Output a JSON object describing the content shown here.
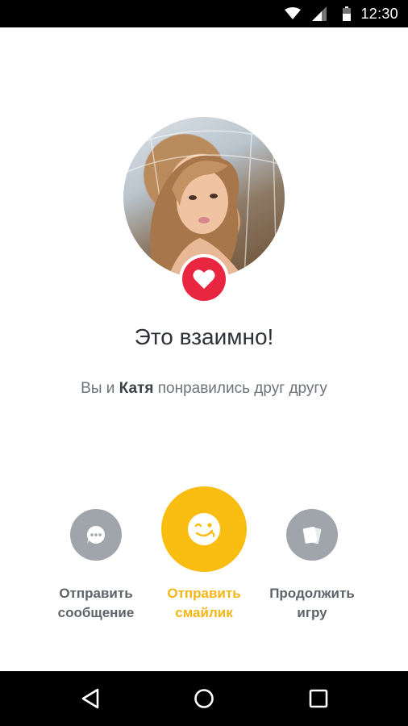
{
  "status_bar": {
    "time": "12:30",
    "icons": [
      "wifi-icon",
      "signal-icon",
      "battery-icon"
    ]
  },
  "match": {
    "title": "Это взаимно!",
    "subtitle_before": "Вы и ",
    "name": "Катя",
    "subtitle_after": " понравились друг другу"
  },
  "actions": {
    "message": {
      "line1": "Отправить",
      "line2": "сообщение",
      "icon": "chat-bubble-icon"
    },
    "smile": {
      "line1": "Отправить",
      "line2": "смайлик",
      "icon": "wink-smiley-icon"
    },
    "game": {
      "line1": "Продолжить",
      "line2": "игру",
      "icon": "cards-icon"
    }
  },
  "nav_bar": {
    "icons": [
      "back-icon",
      "home-icon",
      "recent-apps-icon"
    ]
  },
  "colors": {
    "accent": "#f9bd12",
    "heart": "#e8263f",
    "secondary_button": "#a0a4ab",
    "title_text": "#2e3138"
  }
}
